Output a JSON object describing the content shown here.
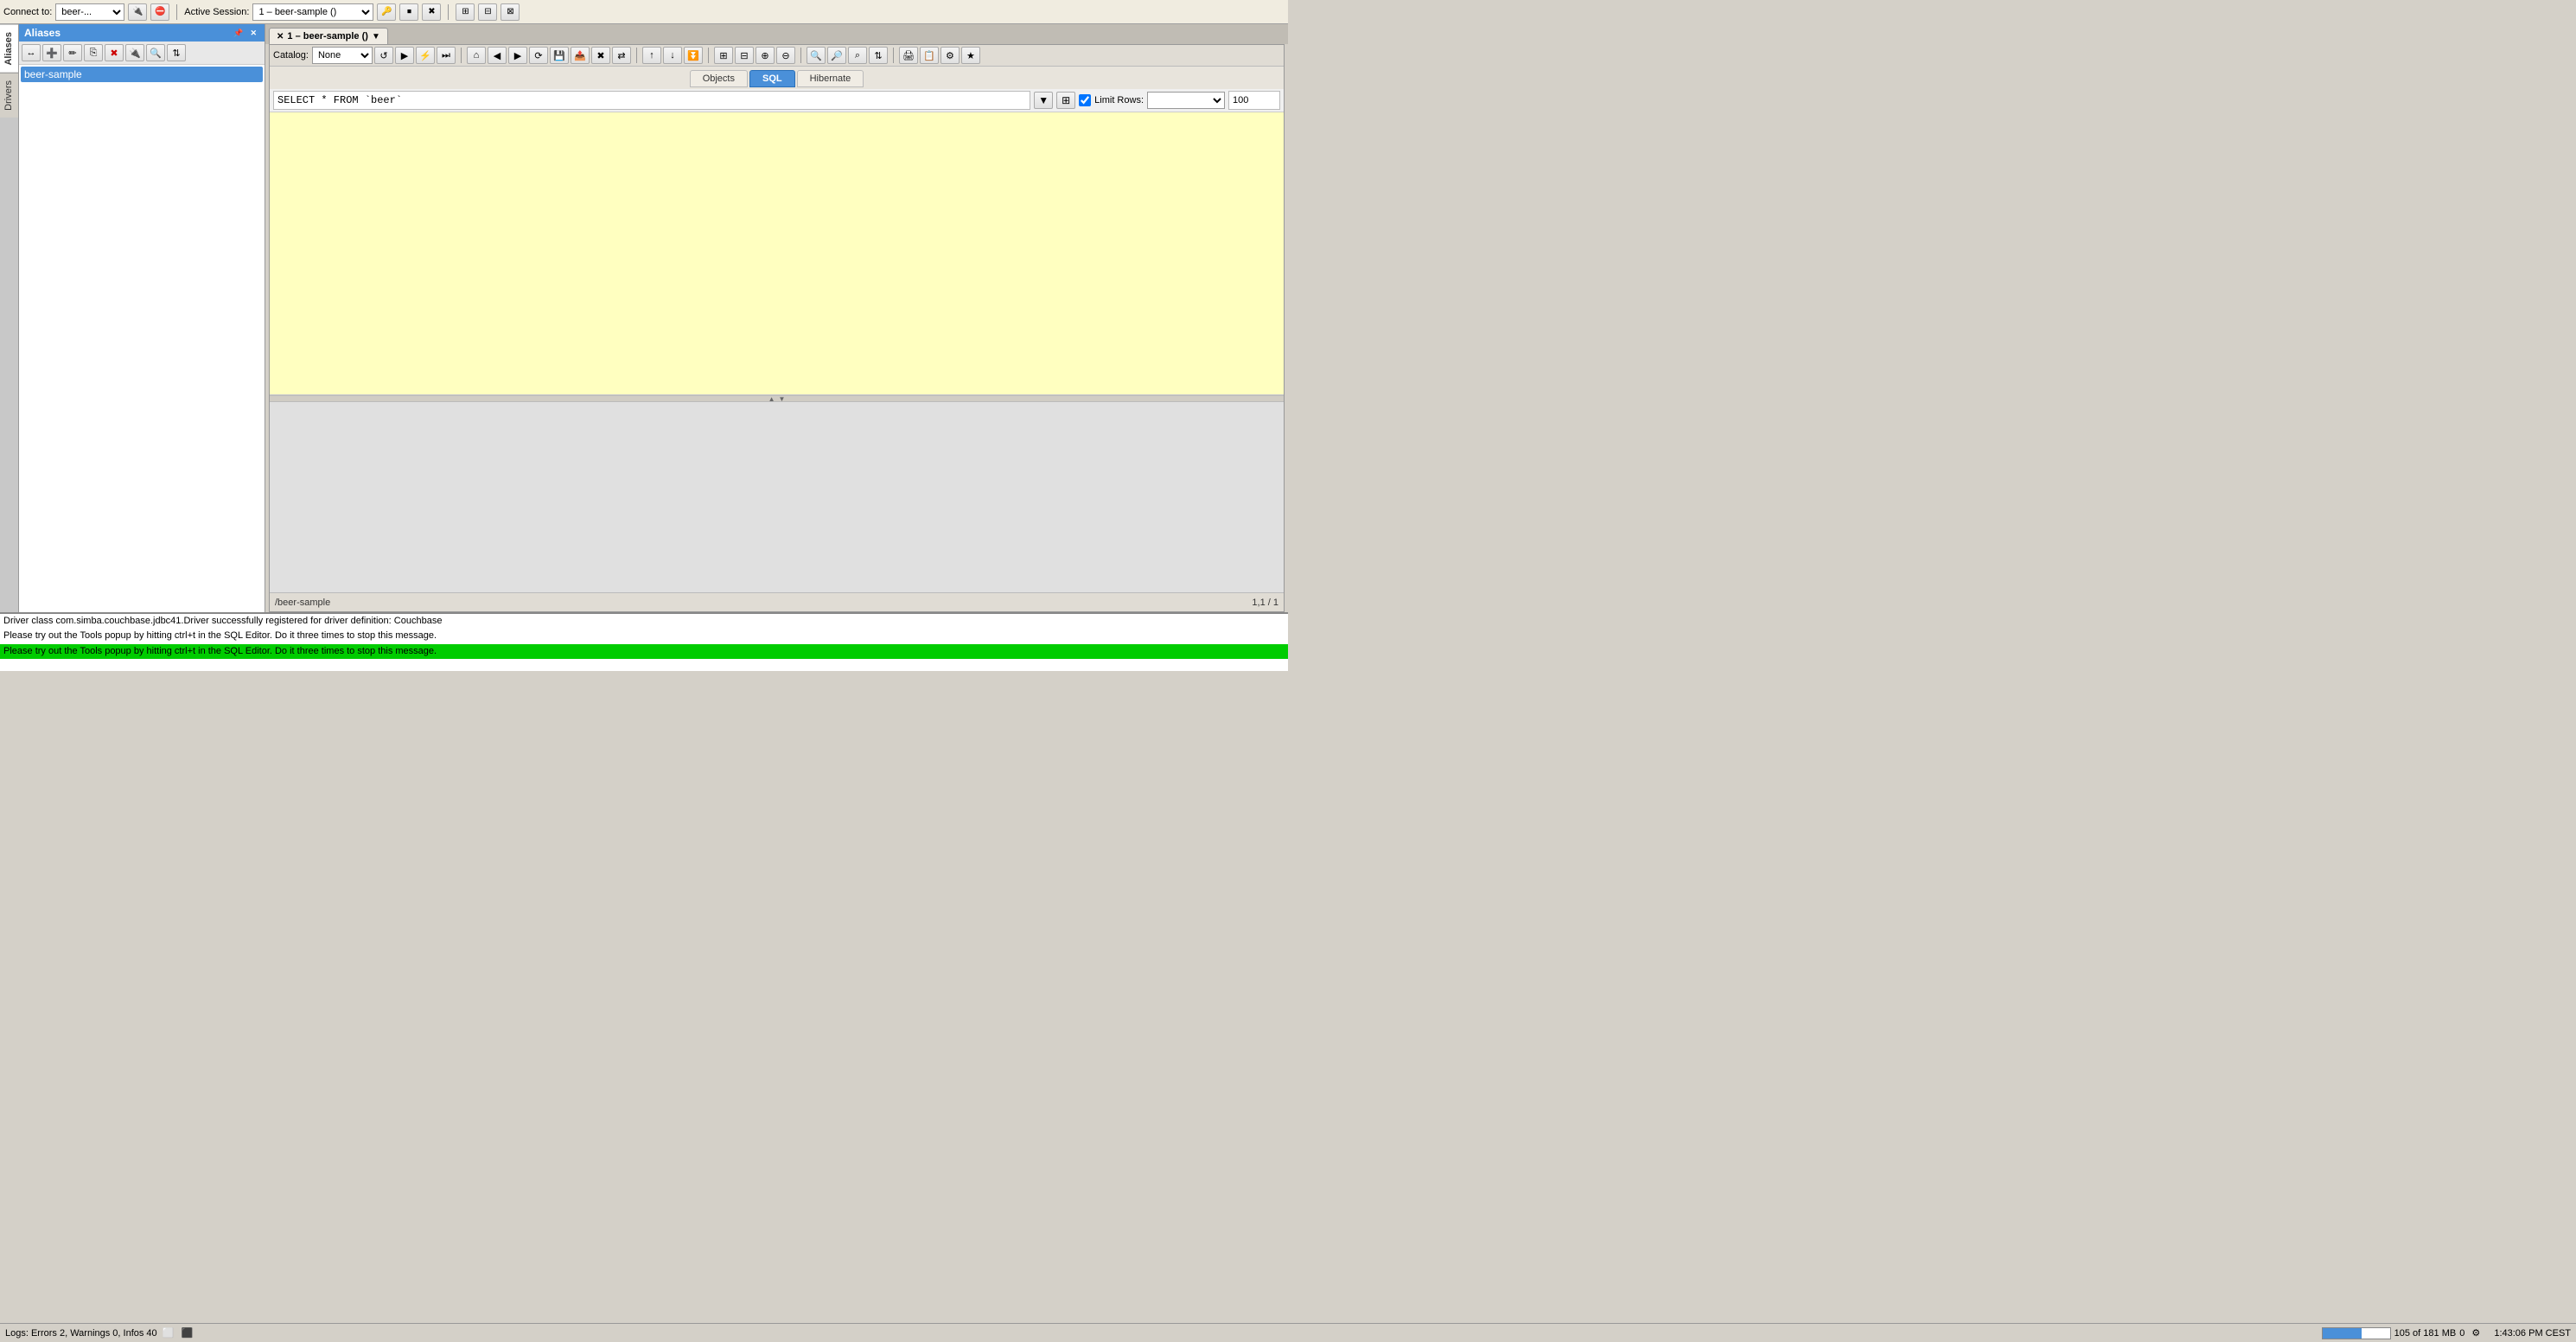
{
  "topToolbar": {
    "connectLabel": "Connect to:",
    "connectValue": "beer-...",
    "activeSessionLabel": "Active Session:",
    "sessionValue": "1 – beer-sample ()",
    "buttons": [
      "connect-icon",
      "disconnect-icon",
      "new-session-icon",
      "stop-icon",
      "abort-icon",
      "clear-icon",
      "commit-icon",
      "rollback-icon",
      "autocommit-icon"
    ]
  },
  "sidebar": {
    "tabs": [
      {
        "label": "Aliases",
        "active": true
      },
      {
        "label": "Drivers",
        "active": false
      }
    ],
    "aliasesHeader": "Aliases",
    "aliasToolbarBtns": [
      "add-icon",
      "edit-icon",
      "copy-icon",
      "delete-icon",
      "connect-icon",
      "browse-icon",
      "sort-icon"
    ],
    "aliases": [
      {
        "name": "beer-sample",
        "selected": true
      }
    ]
  },
  "sessionTab": {
    "closeIcon": "✕",
    "pinIcon": "📌",
    "label": "1 – beer-sample ()",
    "menuIcon": "▼"
  },
  "editorToolbar": {
    "catalogLabel": "Catalog:",
    "catalogValue": "None",
    "catalogOptions": [
      "None"
    ],
    "buttons": [
      "refresh-icon",
      "execute-icon",
      "run-icon",
      "step-icon",
      "home-icon",
      "back-icon",
      "forward-icon",
      "reload-icon",
      "save-icon",
      "export-icon",
      "delete-icon",
      "transfer-icon",
      "up-icon",
      "down-icon",
      "last-icon",
      "expand-icon",
      "collapse-icon",
      "add-col-icon",
      "remove-col-icon",
      "zoom-in-icon",
      "zoom-out-icon",
      "find-icon",
      "sort-icon",
      "filter-icon",
      "print-icon",
      "export2-icon"
    ]
  },
  "subTabs": {
    "tabs": [
      {
        "label": "Objects",
        "active": false
      },
      {
        "label": "SQL",
        "active": true
      },
      {
        "label": "Hibernate",
        "active": false
      }
    ]
  },
  "sqlBar": {
    "query": "SELECT * FROM `beer`",
    "runIcon": "▼",
    "tableIcon": "⊞",
    "limitChecked": true,
    "limitLabel": "Limit Rows:",
    "limitValue": "100"
  },
  "statusPath": {
    "path": "/beer-sample",
    "cursorPos": "1,1 / 1"
  },
  "logs": [
    {
      "text": "Driver class com.simba.couchbase.jdbc41.Driver successfully registered for driver definition: Couchbase",
      "highlighted": false
    },
    {
      "text": "Please try out the Tools popup by hitting ctrl+t in the SQL Editor. Do it three times to stop this message.",
      "highlighted": false
    },
    {
      "text": "Please try out the Tools popup by hitting ctrl+t in the SQL Editor. Do it three times to stop this message.",
      "highlighted": true
    }
  ],
  "statusBar": {
    "logsLabel": "Logs: Errors 2, Warnings 0, Infos 40",
    "memUsed": "105",
    "memTotal": "181",
    "memUnit": "MB",
    "memBarPercent": 58,
    "extraNum": "0",
    "time": "1:43:06 PM CEST"
  }
}
